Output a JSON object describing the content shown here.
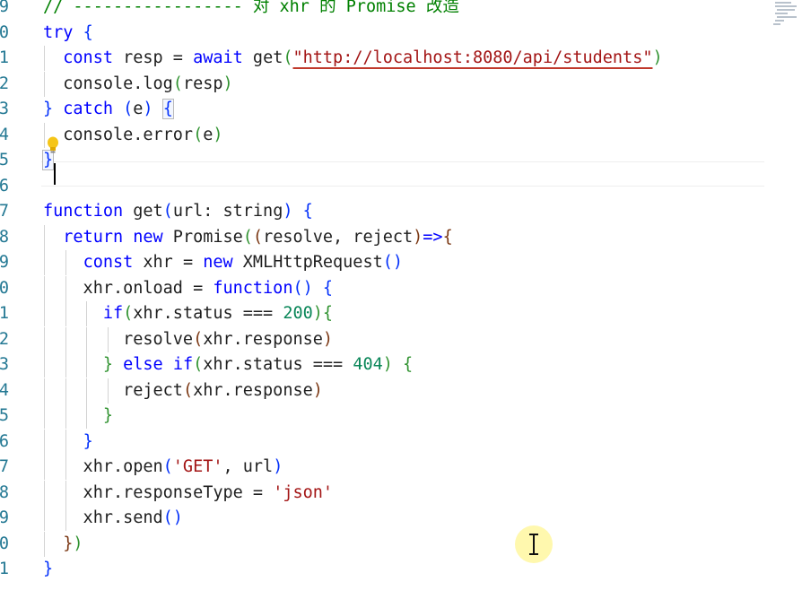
{
  "colors": {
    "keyword": "#0000ff",
    "string": "#a31515",
    "number": "#098658",
    "comment": "#008000",
    "line_number": "#237893",
    "bracket_level_1": "#0431fa",
    "bracket_level_2": "#319331",
    "bracket_level_3": "#7b3814",
    "cursor_highlight": "#fff7a0"
  },
  "editor": {
    "gutter_digits": [
      "9",
      "0",
      "1",
      "2",
      "3",
      "4",
      "5",
      "6",
      "7",
      "8",
      "9",
      "0",
      "1",
      "2",
      "3",
      "4",
      "5",
      "6",
      "7",
      "8",
      "9",
      "0",
      "1"
    ],
    "lines": [
      {
        "tokens": [
          {
            "t": "// ----------------- 对 xhr 的 Promise 改造",
            "c": "cm"
          }
        ]
      },
      {
        "tokens": [
          {
            "t": "try",
            "c": "kw"
          },
          {
            "t": " ",
            "c": "pun"
          },
          {
            "t": "{",
            "c": "b1"
          }
        ]
      },
      {
        "tokens": [
          {
            "t": "  ",
            "c": "pun"
          },
          {
            "t": "const",
            "c": "kw"
          },
          {
            "t": " resp = ",
            "c": "pun"
          },
          {
            "t": "await",
            "c": "kw"
          },
          {
            "t": " get",
            "c": "fn"
          },
          {
            "t": "(",
            "c": "b2"
          },
          {
            "t": "\"http://localhost:8080/api/students\"",
            "c": "str squiggle"
          },
          {
            "t": ")",
            "c": "b2"
          }
        ]
      },
      {
        "tokens": [
          {
            "t": "  console.log",
            "c": "fn"
          },
          {
            "t": "(",
            "c": "b2"
          },
          {
            "t": "resp",
            "c": "pun"
          },
          {
            "t": ")",
            "c": "b2"
          }
        ]
      },
      {
        "tokens": [
          {
            "t": "} ",
            "c": "b1"
          },
          {
            "t": "catch",
            "c": "kw"
          },
          {
            "t": " ",
            "c": "pun"
          },
          {
            "t": "(",
            "c": "b1"
          },
          {
            "t": "e",
            "c": "pun"
          },
          {
            "t": ")",
            "c": "b1"
          },
          {
            "t": " ",
            "c": "pun"
          },
          {
            "t": "{",
            "c": "b1 bracket-match"
          }
        ]
      },
      {
        "tokens": [
          {
            "t": "  console.error",
            "c": "fn"
          },
          {
            "t": "(",
            "c": "b2"
          },
          {
            "t": "e",
            "c": "pun"
          },
          {
            "t": ")",
            "c": "b2"
          }
        ]
      },
      {
        "tokens": [
          {
            "t": "}",
            "c": "b1 bracket-match"
          }
        ]
      },
      {
        "tokens": []
      },
      {
        "tokens": [
          {
            "t": "function",
            "c": "kw"
          },
          {
            "t": " get",
            "c": "fn"
          },
          {
            "t": "(",
            "c": "b1"
          },
          {
            "t": "url: string",
            "c": "pun"
          },
          {
            "t": ")",
            "c": "b1"
          },
          {
            "t": " ",
            "c": "pun"
          },
          {
            "t": "{",
            "c": "b1"
          }
        ]
      },
      {
        "tokens": [
          {
            "t": "  ",
            "c": "pun"
          },
          {
            "t": "return",
            "c": "kw"
          },
          {
            "t": " ",
            "c": "pun"
          },
          {
            "t": "new",
            "c": "kw"
          },
          {
            "t": " Promise",
            "c": "typ"
          },
          {
            "t": "(",
            "c": "b2"
          },
          {
            "t": "(",
            "c": "b3"
          },
          {
            "t": "resolve, reject",
            "c": "pun"
          },
          {
            "t": ")",
            "c": "b3"
          },
          {
            "t": "=>",
            "c": "kw"
          },
          {
            "t": "{",
            "c": "b3"
          }
        ]
      },
      {
        "tokens": [
          {
            "t": "    ",
            "c": "pun"
          },
          {
            "t": "const",
            "c": "kw"
          },
          {
            "t": " xhr = ",
            "c": "pun"
          },
          {
            "t": "new",
            "c": "kw"
          },
          {
            "t": " XMLHttpRequest",
            "c": "typ"
          },
          {
            "t": "()",
            "c": "b1"
          }
        ]
      },
      {
        "tokens": [
          {
            "t": "    xhr.onload = ",
            "c": "pun"
          },
          {
            "t": "function",
            "c": "kw"
          },
          {
            "t": "()",
            "c": "b1"
          },
          {
            "t": " ",
            "c": "pun"
          },
          {
            "t": "{",
            "c": "b1"
          }
        ]
      },
      {
        "tokens": [
          {
            "t": "      ",
            "c": "pun"
          },
          {
            "t": "if",
            "c": "kw"
          },
          {
            "t": "(",
            "c": "b2"
          },
          {
            "t": "xhr.status === ",
            "c": "pun"
          },
          {
            "t": "200",
            "c": "num"
          },
          {
            "t": ")",
            "c": "b2"
          },
          {
            "t": "{",
            "c": "b2"
          }
        ]
      },
      {
        "tokens": [
          {
            "t": "        resolve",
            "c": "fn"
          },
          {
            "t": "(",
            "c": "b3"
          },
          {
            "t": "xhr.response",
            "c": "pun"
          },
          {
            "t": ")",
            "c": "b3"
          }
        ]
      },
      {
        "tokens": [
          {
            "t": "      ",
            "c": "pun"
          },
          {
            "t": "}",
            "c": "b2"
          },
          {
            "t": " ",
            "c": "pun"
          },
          {
            "t": "else",
            "c": "kw"
          },
          {
            "t": " ",
            "c": "pun"
          },
          {
            "t": "if",
            "c": "kw"
          },
          {
            "t": "(",
            "c": "b2"
          },
          {
            "t": "xhr.status === ",
            "c": "pun"
          },
          {
            "t": "404",
            "c": "num"
          },
          {
            "t": ")",
            "c": "b2"
          },
          {
            "t": " ",
            "c": "pun"
          },
          {
            "t": "{",
            "c": "b2"
          }
        ]
      },
      {
        "tokens": [
          {
            "t": "        reject",
            "c": "fn"
          },
          {
            "t": "(",
            "c": "b3"
          },
          {
            "t": "xhr.response",
            "c": "pun"
          },
          {
            "t": ")",
            "c": "b3"
          }
        ]
      },
      {
        "tokens": [
          {
            "t": "      ",
            "c": "pun"
          },
          {
            "t": "}",
            "c": "b2"
          }
        ]
      },
      {
        "tokens": [
          {
            "t": "    ",
            "c": "pun"
          },
          {
            "t": "}",
            "c": "b1"
          }
        ]
      },
      {
        "tokens": [
          {
            "t": "    xhr.open",
            "c": "fn"
          },
          {
            "t": "(",
            "c": "b1"
          },
          {
            "t": "'GET'",
            "c": "str"
          },
          {
            "t": ", url",
            "c": "pun"
          },
          {
            "t": ")",
            "c": "b1"
          }
        ]
      },
      {
        "tokens": [
          {
            "t": "    xhr.responseType = ",
            "c": "pun"
          },
          {
            "t": "'json'",
            "c": "str"
          }
        ]
      },
      {
        "tokens": [
          {
            "t": "    xhr.send",
            "c": "fn"
          },
          {
            "t": "()",
            "c": "b1"
          }
        ]
      },
      {
        "tokens": [
          {
            "t": "  ",
            "c": "pun"
          },
          {
            "t": "}",
            "c": "b3"
          },
          {
            "t": ")",
            "c": "b2"
          }
        ]
      },
      {
        "tokens": [
          {
            "t": "}",
            "c": "b1"
          }
        ]
      }
    ]
  },
  "icons": {
    "lightbulb": "lightbulb-icon",
    "text_cursor": "text-cursor-icon",
    "minimap": "minimap"
  }
}
